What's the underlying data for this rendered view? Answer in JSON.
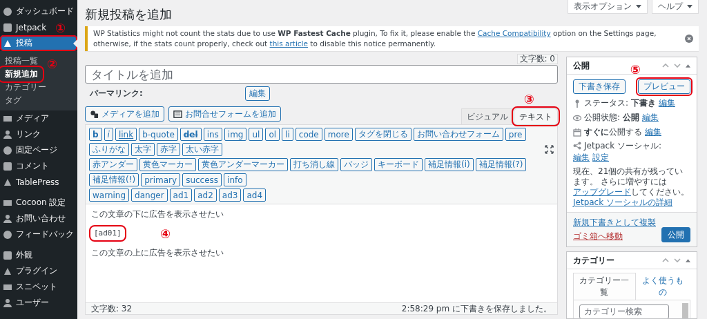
{
  "screen_options": [
    {
      "label": "表示オプション"
    },
    {
      "label": "ヘルプ"
    }
  ],
  "sidebar": {
    "sections": [
      {
        "items": [
          {
            "label": "ダッシュボード",
            "selected": false
          },
          {
            "label": "Jetpack",
            "selected": false
          },
          {
            "label": "投稿",
            "selected": true,
            "annotation": "①",
            "children": [
              {
                "label": "投稿一覧",
                "selected": false
              },
              {
                "label": "新規追加",
                "selected": true,
                "annotation": "②"
              },
              {
                "label": "カテゴリー",
                "selected": false
              },
              {
                "label": "タグ",
                "selected": false
              }
            ]
          },
          {
            "label": "メディア",
            "selected": false
          },
          {
            "label": "リンク",
            "selected": false
          },
          {
            "label": "固定ページ",
            "selected": false
          },
          {
            "label": "コメント",
            "selected": false
          },
          {
            "label": "TablePress",
            "selected": false
          }
        ]
      },
      {
        "items": [
          {
            "label": "Cocoon 設定",
            "selected": false
          },
          {
            "label": "お問い合わせ",
            "selected": false
          },
          {
            "label": "フィードバック",
            "selected": false
          }
        ]
      },
      {
        "items": [
          {
            "label": "外観",
            "selected": false
          },
          {
            "label": "プラグイン",
            "selected": false
          },
          {
            "label": "スニペット",
            "selected": false
          },
          {
            "label": "ユーザー",
            "selected": false
          }
        ]
      }
    ]
  },
  "page_title": "新規投稿を追加",
  "notice": {
    "parts": [
      {
        "kind": "text",
        "text": "WP Statistics might not count the stats due to use **WP Fastest Cache** plugin, To fix it, please enable the"
      },
      {
        "kind": "link",
        "text": "Cache Compatibility"
      },
      {
        "kind": "text",
        "text": "option on the Settings page, otherwise, if the stats count properly, check out"
      },
      {
        "kind": "link",
        "text": "this article"
      },
      {
        "kind": "text",
        "text": "to disable this notice permanently."
      }
    ]
  },
  "editor": {
    "word_count_top": "文字数: 0",
    "title_placeholder": "タイトルを追加",
    "permalink_label": "パーマリンク:",
    "permalink_edit": "編集",
    "media_buttons": [
      "メディアを追加",
      "お問合せフォームを追加"
    ],
    "tabs": [
      {
        "label": "ビジュアル",
        "selected": false
      },
      {
        "label": "テキスト",
        "selected": true,
        "annotation": "③"
      }
    ],
    "quicktag_rows": [
      [
        {
          "label": "b",
          "kind": "bold"
        },
        {
          "label": "i",
          "kind": "italic"
        },
        {
          "label": "link",
          "kind": "link"
        },
        {
          "label": "b-quote",
          "kind": "plain"
        },
        {
          "label": "del",
          "kind": "strike"
        },
        {
          "label": "ins",
          "kind": "plain"
        },
        {
          "label": "img",
          "kind": "plain"
        },
        {
          "label": "ul",
          "kind": "plain"
        },
        {
          "label": "ol",
          "kind": "plain"
        },
        {
          "label": "li",
          "kind": "plain"
        },
        {
          "label": "code",
          "kind": "plain"
        },
        {
          "label": "more",
          "kind": "plain"
        },
        {
          "label": "タグを閉じる",
          "kind": "plain"
        },
        {
          "label": "お問い合わせフォーム",
          "kind": "plain"
        },
        {
          "label": "pre",
          "kind": "plain"
        },
        {
          "label": "ふりがな",
          "kind": "plain"
        },
        {
          "label": "太字",
          "kind": "plain"
        },
        {
          "label": "赤字",
          "kind": "plain"
        },
        {
          "label": "太い赤字",
          "kind": "plain"
        }
      ],
      [
        {
          "label": "赤アンダー",
          "kind": "plain"
        },
        {
          "label": "黄色マーカー",
          "kind": "plain"
        },
        {
          "label": "黄色アンダーマーカー",
          "kind": "plain"
        },
        {
          "label": "打ち消し線",
          "kind": "plain"
        },
        {
          "label": "バッジ",
          "kind": "plain"
        },
        {
          "label": "キーボード",
          "kind": "plain"
        },
        {
          "label": "補足情報(i)",
          "kind": "plain"
        },
        {
          "label": "補足情報(?)",
          "kind": "plain"
        },
        {
          "label": "補足情報(!)",
          "kind": "plain"
        },
        {
          "label": "primary",
          "kind": "plain"
        },
        {
          "label": "success",
          "kind": "plain"
        },
        {
          "label": "info",
          "kind": "plain"
        }
      ],
      [
        {
          "label": "warning",
          "kind": "plain"
        },
        {
          "label": "danger",
          "kind": "plain"
        },
        {
          "label": "ad1",
          "kind": "plain"
        },
        {
          "label": "ad2",
          "kind": "plain"
        },
        {
          "label": "ad3",
          "kind": "plain"
        },
        {
          "label": "ad4",
          "kind": "plain"
        }
      ]
    ],
    "content": [
      {
        "kind": "text",
        "text": "この文章の下に広告を表示させたい"
      },
      {
        "kind": "code",
        "text": "[ad01]",
        "annotation": "④"
      },
      {
        "kind": "text",
        "text": "この文章の上に広告を表示させたい"
      }
    ],
    "word_count": "文字数: 32",
    "autosave": "2:58:29 pm に下書きを保存しました。"
  },
  "publish": {
    "title": "公開",
    "save_draft": "下書き保存",
    "preview": {
      "label": "プレビュー",
      "annotation": "⑤"
    },
    "rows": [
      {
        "kind": "status",
        "text": "ステータス: **下書き**",
        "link": "編集"
      },
      {
        "kind": "visibility",
        "text": "公開状態: **公開**",
        "link": "編集"
      },
      {
        "kind": "schedule",
        "text": "**すぐに**公開する",
        "link": "編集"
      }
    ],
    "jetpack": {
      "label": "Jetpack ソーシャル:",
      "links": [
        "編集",
        "設定"
      ],
      "note_before": "現在、21個の共有が残っています。 さらに増やすには",
      "note_link": "アップグレード",
      "note_after": "してください。",
      "details_link": "Jetpack ソーシャルの詳細"
    },
    "copy_link": "新規下書きとして複製",
    "trash_link": "ゴミ箱へ移動",
    "publish_button": "公開"
  },
  "categories": {
    "title": "カテゴリー",
    "tabs": [
      {
        "label": "カテゴリー一覧",
        "selected": true
      },
      {
        "label": "よく使うもの",
        "selected": false
      }
    ],
    "search_placeholder": "カテゴリー検索"
  }
}
